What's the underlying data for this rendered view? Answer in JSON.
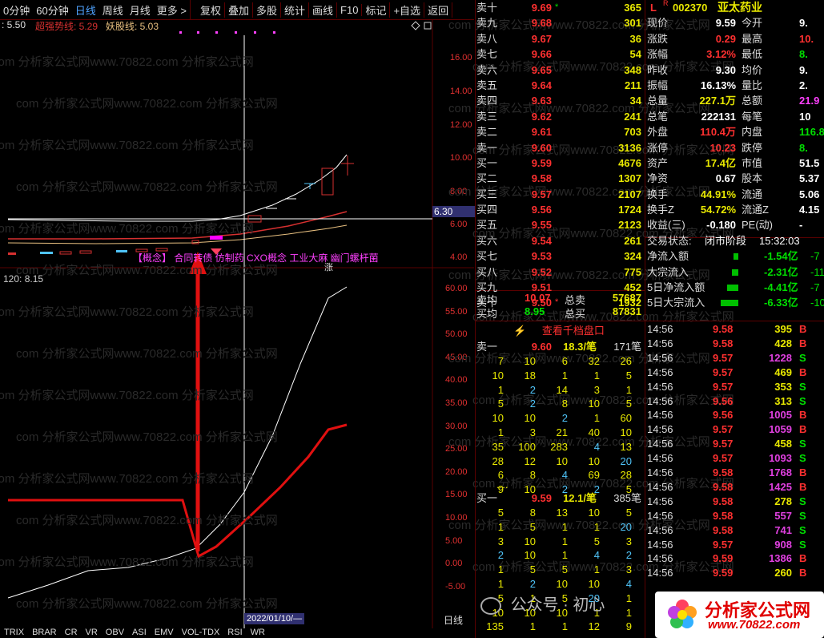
{
  "toolbar": {
    "items": [
      "0分钟",
      "60分钟",
      "日线",
      "周线",
      "月线",
      "更多 >",
      "复权",
      "叠加",
      "多股",
      "统计",
      "画线",
      "F10",
      "标记",
      "+自选",
      "返回"
    ]
  },
  "indicators_top": {
    "prefix": ": 5.50",
    "line1": "超强势线: 5.29",
    "line2": "妖股线: 5.03"
  },
  "price_axis": [
    "16.00",
    "14.00",
    "12.00",
    "10.00",
    "8.00",
    "6.00",
    "4.00"
  ],
  "price_marker": "6.30",
  "concept_bar": "【概念】 合同转债 仿制药 CXO概念 工业大麻 幽门螺杆菌",
  "zhang": "涨",
  "lower_indicator": "120: 8.15",
  "lower_axis": [
    "60.00",
    "55.00",
    "50.00",
    "45.00",
    "40.00",
    "35.00",
    "30.00",
    "25.00",
    "20.00",
    "15.00",
    "10.00",
    "5.00",
    "0.00",
    "-5.00"
  ],
  "cursor_date": "2022/01/10/—",
  "period_label": "日线",
  "bottom_tabs": [
    "TRIX",
    "BRAR",
    "CR",
    "VR",
    "OBV",
    "ASI",
    "EMV",
    "VOL-TDX",
    "RSI",
    "WR"
  ],
  "watermark": "com 分析家公式网www.70822.com 分析家公式网",
  "orderbook": {
    "asks": [
      {
        "label": "卖十",
        "price": "9.69",
        "vol": "365",
        "mark": "*"
      },
      {
        "label": "卖九",
        "price": "9.68",
        "vol": "301"
      },
      {
        "label": "卖八",
        "price": "9.67",
        "vol": "36"
      },
      {
        "label": "卖七",
        "price": "9.66",
        "vol": "54"
      },
      {
        "label": "卖六",
        "price": "9.65",
        "vol": "348"
      },
      {
        "label": "卖五",
        "price": "9.64",
        "vol": "211"
      },
      {
        "label": "卖四",
        "price": "9.63",
        "vol": "34"
      },
      {
        "label": "卖三",
        "price": "9.62",
        "vol": "241"
      },
      {
        "label": "卖二",
        "price": "9.61",
        "vol": "703"
      },
      {
        "label": "卖一",
        "price": "9.60",
        "vol": "3136"
      }
    ],
    "bids": [
      {
        "label": "买一",
        "price": "9.59",
        "vol": "4676"
      },
      {
        "label": "买二",
        "price": "9.58",
        "vol": "1307"
      },
      {
        "label": "买三",
        "price": "9.57",
        "vol": "2107"
      },
      {
        "label": "买四",
        "price": "9.56",
        "vol": "1724"
      },
      {
        "label": "买五",
        "price": "9.55",
        "vol": "2123"
      },
      {
        "label": "买六",
        "price": "9.54",
        "vol": "261"
      },
      {
        "label": "买七",
        "price": "9.53",
        "vol": "324"
      },
      {
        "label": "买八",
        "price": "9.52",
        "vol": "775"
      },
      {
        "label": "买九",
        "price": "9.51",
        "vol": "452"
      },
      {
        "label": "买十",
        "price": "9.50",
        "vol": "1932",
        "mark": "*"
      }
    ],
    "avg_sell_label": "卖均",
    "avg_sell": "10.07",
    "total_sell_label": "总卖",
    "total_sell": "57687",
    "avg_buy_label": "买均",
    "avg_buy": "8.95",
    "total_buy_label": "总买",
    "total_buy": "87831",
    "depth_button": "查看千档盘口"
  },
  "quote": {
    "code": "002370",
    "name": "亚太药业",
    "rows": [
      [
        "现价",
        "9.59",
        "今开",
        "9."
      ],
      [
        "涨跌",
        "0.29",
        "最高",
        "10."
      ],
      [
        "涨幅",
        "3.12%",
        "最低",
        "8."
      ],
      [
        "昨收",
        "9.30",
        "均价",
        "9."
      ],
      [
        "振幅",
        "16.13%",
        "量比",
        "2."
      ],
      [
        "总量",
        "227.1万",
        "总额",
        "21.9"
      ],
      [
        "总笔",
        "222131",
        "每笔",
        "10"
      ],
      [
        "外盘",
        "110.4万",
        "内盘",
        "116.8"
      ],
      [
        "涨停",
        "10.23",
        "跌停",
        "8."
      ],
      [
        "资产",
        "17.4亿",
        "市值",
        "51.5"
      ],
      [
        "净资",
        "0.67",
        "股本",
        "5.37"
      ],
      [
        "换手",
        "44.91%",
        "流通",
        "5.06"
      ],
      [
        "换手Z",
        "54.72%",
        "流通Z",
        "4.15"
      ],
      [
        "收益(三)",
        "-0.180",
        "PE(动)",
        "-"
      ]
    ],
    "status_label": "交易状态:",
    "status": "闭市阶段",
    "time": "15:32:03",
    "flows": [
      [
        "净流入额",
        "-1.54亿",
        "-7"
      ],
      [
        "大宗流入",
        "-2.31亿",
        "-11"
      ],
      [
        "5日净流入额",
        "-4.41亿",
        "-7"
      ],
      [
        "5日大宗流入",
        "-6.33亿",
        "-10"
      ]
    ]
  },
  "depth": {
    "sell_label": "卖一",
    "sell_price": "9.60",
    "sell_avg": "18.3/笔",
    "sell_count": "171笔",
    "sell_rows": [
      [
        "7",
        "10",
        "6",
        "32",
        "26"
      ],
      [
        "10",
        "18",
        "1",
        "1",
        "5"
      ],
      [
        "1",
        "2",
        "14",
        "3",
        "1"
      ],
      [
        "5",
        "2",
        "8",
        "10",
        "5"
      ],
      [
        "10",
        "10",
        "2",
        "1",
        "60"
      ],
      [
        "1",
        "3",
        "21",
        "40",
        "10"
      ],
      [
        "35",
        "100",
        "283",
        "4",
        "13"
      ],
      [
        "28",
        "12",
        "10",
        "10",
        "20"
      ],
      [
        "6",
        "8",
        "4",
        "69",
        "28"
      ],
      [
        "9",
        "10",
        "2",
        "2",
        "5"
      ]
    ],
    "ellipsis": "....",
    "buy_label": "买一",
    "buy_price": "9.59",
    "buy_avg": "12.1/笔",
    "buy_count": "385笔",
    "buy_rows": [
      [
        "5",
        "8",
        "13",
        "10",
        "5"
      ],
      [
        "1",
        "5",
        "1",
        "1",
        "20"
      ],
      [
        "3",
        "10",
        "1",
        "5",
        "3"
      ],
      [
        "2",
        "10",
        "1",
        "4",
        "2"
      ],
      [
        "1",
        "5",
        "5",
        "1",
        "3"
      ],
      [
        "1",
        "2",
        "10",
        "10",
        "4"
      ],
      [
        "5",
        "1",
        "5",
        "20",
        "1"
      ],
      [
        "10",
        "10",
        "10",
        "1",
        "1"
      ],
      [
        "135",
        "1",
        "1",
        "12",
        "9"
      ]
    ]
  },
  "trades": [
    [
      "14:56",
      "9.58",
      "395",
      "B"
    ],
    [
      "14:56",
      "9.58",
      "428",
      "B"
    ],
    [
      "14:56",
      "9.57",
      "1228",
      "S"
    ],
    [
      "14:56",
      "9.57",
      "469",
      "B"
    ],
    [
      "14:56",
      "9.57",
      "353",
      "S"
    ],
    [
      "14:56",
      "9.56",
      "313",
      "S"
    ],
    [
      "14:56",
      "9.56",
      "1005",
      "B"
    ],
    [
      "14:56",
      "9.57",
      "1059",
      "B"
    ],
    [
      "14:56",
      "9.57",
      "458",
      "S"
    ],
    [
      "14:56",
      "9.57",
      "1093",
      "S"
    ],
    [
      "14:56",
      "9.58",
      "1768",
      "B"
    ],
    [
      "14:56",
      "9.58",
      "1425",
      "B"
    ],
    [
      "14:56",
      "9.58",
      "278",
      "S"
    ],
    [
      "14:56",
      "9.58",
      "557",
      "S"
    ],
    [
      "14:56",
      "9.58",
      "741",
      "S"
    ],
    [
      "14:56",
      "9.57",
      "908",
      "S"
    ],
    [
      "14:56",
      "9.59",
      "1386",
      "B"
    ],
    [
      "14:56",
      "9.59",
      "260",
      "B"
    ]
  ],
  "wechat": "公众号 · 初心",
  "logo": {
    "title": "分析家公式网",
    "url": "www.70822.com"
  },
  "colors": {
    "up": "#ff3030",
    "down": "#00e000",
    "vol": "#e8e800",
    "accent": "#4fa3ff"
  }
}
